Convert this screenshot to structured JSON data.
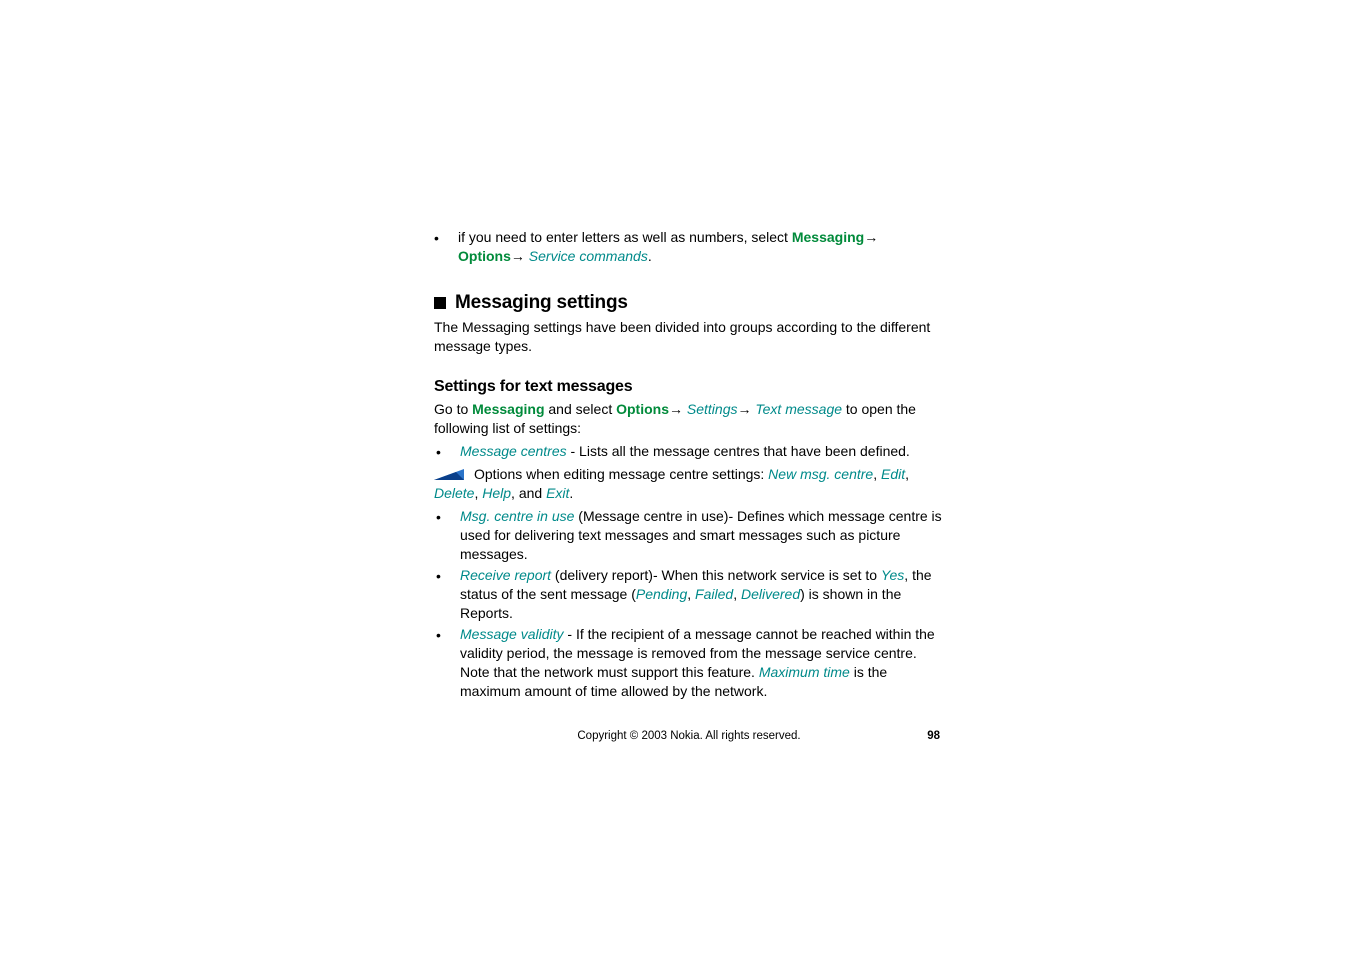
{
  "intro": {
    "bullet": "•",
    "text_prefix": "if you need to enter letters as well as numbers, select ",
    "messaging": "Messaging",
    "arrow1": "→ ",
    "options": "Options",
    "arrow2": "→ ",
    "service_commands": "Service commands",
    "period": "."
  },
  "section": {
    "title": "Messaging settings",
    "para": "The Messaging settings have been divided into groups according to the different message types."
  },
  "sub": {
    "title": "Settings for text messages",
    "lead_prefix": "Go to ",
    "lead_messaging": "Messaging",
    "lead_mid1": " and select ",
    "lead_options": "Options",
    "lead_arrow1": "→ ",
    "lead_settings": "Settings",
    "lead_arrow2": "→ ",
    "lead_textmsg": "Text message",
    "lead_suffix": " to open the following list of settings:"
  },
  "items": {
    "i1_bullet": "•",
    "i1_term": "Message centres",
    "i1_rest": " - Lists all the message centres that have been defined.",
    "note_prefix": "Options when editing message centre settings: ",
    "note_new": "New msg. centre",
    "note_c1": ", ",
    "note_edit": "Edit",
    "note_c2": ", ",
    "note_delete": "Delete",
    "note_c3": ", ",
    "note_help": "Help",
    "note_c4": ", and ",
    "note_exit": "Exit",
    "note_period": ".",
    "i2_bullet": "•",
    "i2_term": "Msg. centre in use",
    "i2_rest": " (Message centre in use)- Defines which message centre is used for delivering text messages and smart messages such as picture messages.",
    "i3_bullet": "•",
    "i3_term": "Receive report",
    "i3_mid1": " (delivery report)- When this network service is set to ",
    "i3_yes": "Yes",
    "i3_mid2": ", the status of the sent message (",
    "i3_pending": "Pending",
    "i3_c1": ", ",
    "i3_failed": "Failed",
    "i3_c2": ", ",
    "i3_delivered": "Delivered",
    "i3_mid3": ") is shown in the Reports.",
    "i4_bullet": "•",
    "i4_term": "Message validity",
    "i4_mid1": " - If the recipient of a message cannot be reached within the validity period, the message is removed from the message service centre. Note that the network must support this feature. ",
    "i4_max": "Maximum time",
    "i4_mid2": " is the maximum amount of time allowed by the network."
  },
  "footer": {
    "copyright": "Copyright © 2003 Nokia. All rights reserved.",
    "page": "98"
  },
  "icons": {
    "note_triangle": "note-triangle-icon"
  }
}
